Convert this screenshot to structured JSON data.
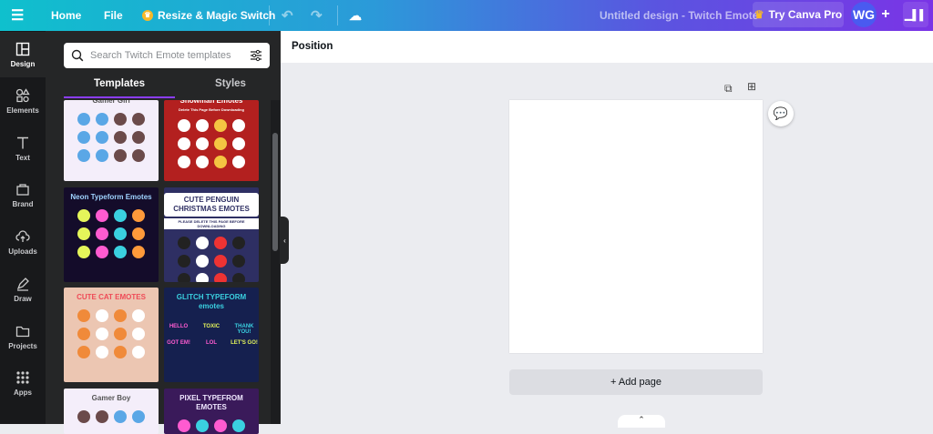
{
  "topbar": {
    "home": "Home",
    "file": "File",
    "resize": "Resize & Magic Switch",
    "title": "Untitled design - Twitch Emote",
    "try_pro": "Try Canva Pro",
    "avatar": "WG",
    "add": "+"
  },
  "rail": [
    {
      "label": "Design"
    },
    {
      "label": "Elements"
    },
    {
      "label": "Text"
    },
    {
      "label": "Brand"
    },
    {
      "label": "Uploads"
    },
    {
      "label": "Draw"
    },
    {
      "label": "Projects"
    },
    {
      "label": "Apps"
    }
  ],
  "panel": {
    "search_placeholder": "Search Twitch Emote templates",
    "tabs": [
      "Templates",
      "Styles"
    ],
    "templates": [
      {
        "title": "Gamer Girl",
        "bg": "#f4eefa",
        "fg": "#555"
      },
      {
        "title": "Snowman Emotes",
        "bg": "#b3201f",
        "fg": "#fff",
        "sub": "Delete This Page Before Downloading"
      },
      {
        "title": "Neon Typeform Emotes",
        "bg": "#140c2a",
        "fg": "#9fd3ff"
      },
      {
        "title": "CUTE PENGUIN CHRISTMAS EMOTES",
        "bg": "#2e2f63",
        "fg": "#2e2f63",
        "sub": "PLEASE DELETE THIS PAGE BEFORE DOWNLOADING"
      },
      {
        "title": "CUTE CAT EMOTES",
        "bg": "#ecc6b2",
        "fg": "#ef4b57"
      },
      {
        "title": "GLITCH TYPEFORM emotes",
        "bg": "#15204f",
        "fg": "#3ad0e0",
        "words": [
          "HELLO",
          "TOXIC",
          "THANK YOU!",
          "GOT EM!",
          "LOL",
          "LET'S GO!"
        ]
      },
      {
        "title": "Gamer Boy",
        "bg": "#f4eefa",
        "fg": "#555"
      },
      {
        "title": "PIXEL TYPEFROM EMOTES",
        "bg": "#3a1a5a",
        "fg": "#f0e8ff"
      }
    ]
  },
  "editor": {
    "position": "Position",
    "add_page": "+ Add page"
  }
}
